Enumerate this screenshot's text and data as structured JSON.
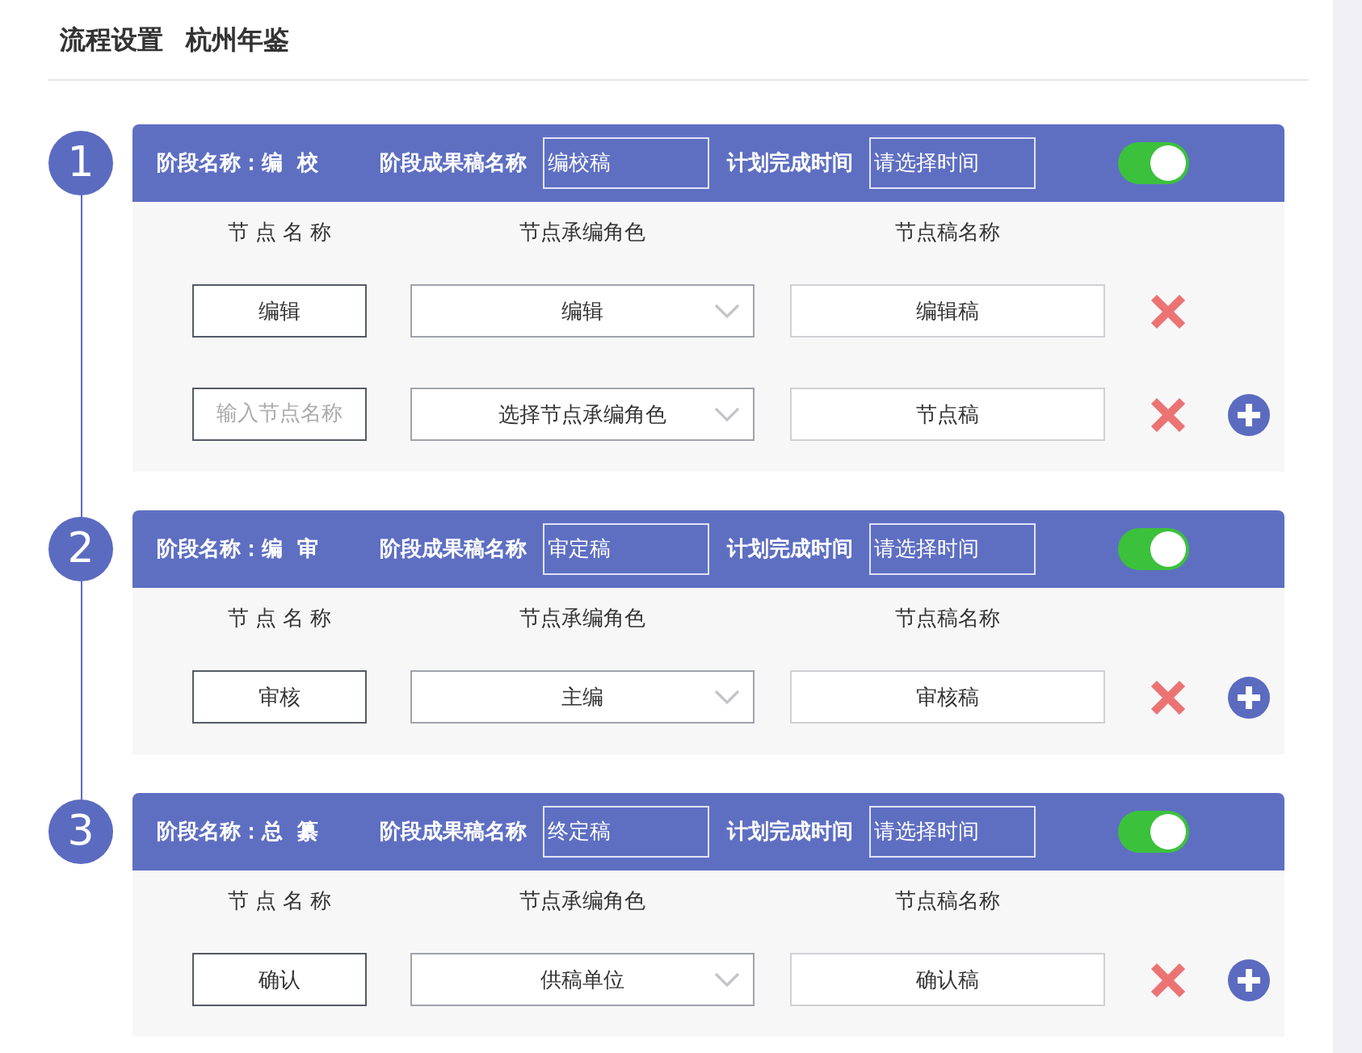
{
  "page": {
    "title": "流程设置",
    "subtitle": "杭州年鉴"
  },
  "stages": [
    {
      "number": "1",
      "name_label": "阶段名称：",
      "name": "编  校",
      "output_label": "阶段成果稿名称",
      "output": "编校稿",
      "deadline_label": "计划完成时间",
      "deadline_placeholder": "请选择时间",
      "enabled": true,
      "columns": [
        "节 点 名 称",
        "节点承编角色",
        "节点稿名称"
      ],
      "nodes": [
        {
          "name": "编辑",
          "role": "编辑",
          "draft": "编辑稿",
          "can_add": false
        },
        {
          "name_placeholder": "输入节点名称",
          "role": "选择节点承编角色",
          "draft": "节点稿",
          "can_add": true
        }
      ]
    },
    {
      "number": "2",
      "name_label": "阶段名称：",
      "name": "编  审",
      "output_label": "阶段成果稿名称",
      "output": "审定稿",
      "deadline_label": "计划完成时间",
      "deadline_placeholder": "请选择时间",
      "enabled": true,
      "columns": [
        "节 点 名 称",
        "节点承编角色",
        "节点稿名称"
      ],
      "nodes": [
        {
          "name": "审核",
          "role": "主编",
          "draft": "审核稿",
          "can_add": true
        }
      ]
    },
    {
      "number": "3",
      "name_label": "阶段名称：",
      "name": "总  纂",
      "output_label": "阶段成果稿名称",
      "output": "终定稿",
      "deadline_label": "计划完成时间",
      "deadline_placeholder": "请选择时间",
      "enabled": true,
      "columns": [
        "节 点 名 称",
        "节点承编角色",
        "节点稿名称"
      ],
      "nodes": [
        {
          "name": "确认",
          "role": "供稿单位",
          "draft": "确认稿",
          "can_add": true
        }
      ]
    }
  ]
}
